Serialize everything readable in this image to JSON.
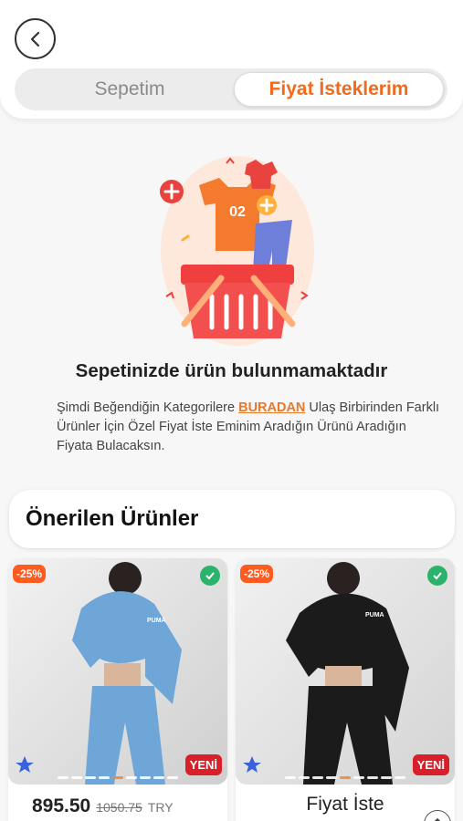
{
  "header": {
    "back_icon": "chevron-left-icon",
    "tabs": [
      {
        "label": "Sepetim",
        "active": false
      },
      {
        "label": "Fiyat İsteklerim",
        "active": true
      }
    ]
  },
  "empty_state": {
    "illustration": "shopping-basket-icon",
    "illustration_text": "02",
    "title": "Sepetinizde ürün bulunmamaktadır",
    "desc_before": "Şimdi Beğendiğin Kategorilere ",
    "link": "BURADAN",
    "desc_after": " Ulaş Birbirinden Farklı Ürünler İçin Özel Fiyat İste Eminim Aradığın Ürünü Aradığın Fiyata Bulacaksın."
  },
  "recommended": {
    "title": "Önerilen Ürünler",
    "products": [
      {
        "discount": "-25%",
        "new_badge": "YENİ",
        "logo_text": "PUMA",
        "price": "895.50",
        "old_price": "1050.75",
        "currency": "TRY",
        "color": "#6fa6d8"
      },
      {
        "discount": "-25%",
        "new_badge": "YENİ",
        "logo_text": "PUMA",
        "action": "Fiyat İste",
        "color": "#1b1b1b"
      }
    ]
  },
  "colors": {
    "accent": "#f26a1b",
    "discount": "#ff5a1f",
    "new": "#d81f2a",
    "check": "#2bb36b"
  }
}
